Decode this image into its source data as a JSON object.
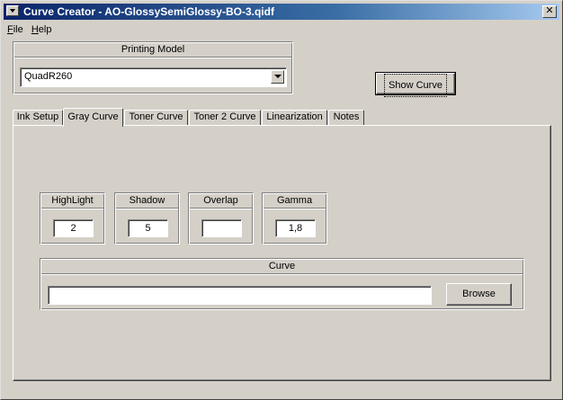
{
  "window": {
    "title": "Curve Creator - AO-GlossySemiGlossy-BO-3.qidf",
    "close_glyph": "✕"
  },
  "menu": [
    {
      "label_mnemonic": "F",
      "label_rest": "ile"
    },
    {
      "label_mnemonic": "H",
      "label_rest": "elp"
    }
  ],
  "printing_model": {
    "header": "Printing Model",
    "selected": "QuadR260"
  },
  "show_curve_button": "Show Curve",
  "tabs": [
    "Ink Setup",
    "Gray Curve",
    "Toner Curve",
    "Toner 2 Curve",
    "Linearization",
    "Notes"
  ],
  "active_tab": "Gray Curve",
  "fields": {
    "highlight": {
      "label": "HighLight",
      "value": "2"
    },
    "shadow": {
      "label": "Shadow",
      "value": "5"
    },
    "overlap": {
      "label": "Overlap",
      "value": ""
    },
    "gamma": {
      "label": "Gamma",
      "value": "1,8"
    }
  },
  "curve": {
    "header": "Curve",
    "value": "",
    "browse_label": "Browse"
  },
  "colors": {
    "face": "#d4d0c8",
    "title_start": "#0a246a",
    "title_end": "#a6caf0"
  },
  "icons": {
    "system_menu": "system-menu-icon",
    "close": "close-icon",
    "dropdown": "chevron-down-icon"
  }
}
